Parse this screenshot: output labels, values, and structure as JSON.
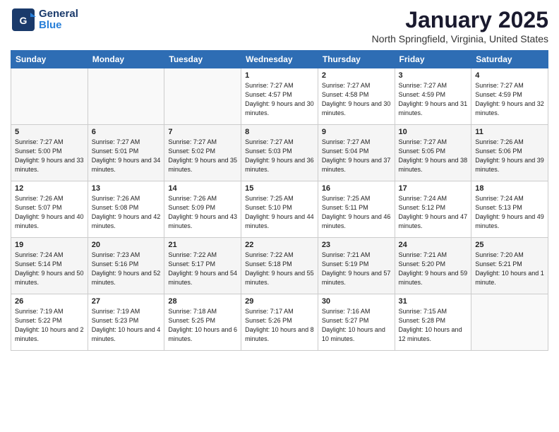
{
  "header": {
    "logo_general": "General",
    "logo_blue": "Blue",
    "month": "January 2025",
    "location": "North Springfield, Virginia, United States"
  },
  "weekdays": [
    "Sunday",
    "Monday",
    "Tuesday",
    "Wednesday",
    "Thursday",
    "Friday",
    "Saturday"
  ],
  "weeks": [
    [
      {
        "day": "",
        "sunrise": "",
        "sunset": "",
        "daylight": ""
      },
      {
        "day": "",
        "sunrise": "",
        "sunset": "",
        "daylight": ""
      },
      {
        "day": "",
        "sunrise": "",
        "sunset": "",
        "daylight": ""
      },
      {
        "day": "1",
        "sunrise": "Sunrise: 7:27 AM",
        "sunset": "Sunset: 4:57 PM",
        "daylight": "Daylight: 9 hours and 30 minutes."
      },
      {
        "day": "2",
        "sunrise": "Sunrise: 7:27 AM",
        "sunset": "Sunset: 4:58 PM",
        "daylight": "Daylight: 9 hours and 30 minutes."
      },
      {
        "day": "3",
        "sunrise": "Sunrise: 7:27 AM",
        "sunset": "Sunset: 4:59 PM",
        "daylight": "Daylight: 9 hours and 31 minutes."
      },
      {
        "day": "4",
        "sunrise": "Sunrise: 7:27 AM",
        "sunset": "Sunset: 4:59 PM",
        "daylight": "Daylight: 9 hours and 32 minutes."
      }
    ],
    [
      {
        "day": "5",
        "sunrise": "Sunrise: 7:27 AM",
        "sunset": "Sunset: 5:00 PM",
        "daylight": "Daylight: 9 hours and 33 minutes."
      },
      {
        "day": "6",
        "sunrise": "Sunrise: 7:27 AM",
        "sunset": "Sunset: 5:01 PM",
        "daylight": "Daylight: 9 hours and 34 minutes."
      },
      {
        "day": "7",
        "sunrise": "Sunrise: 7:27 AM",
        "sunset": "Sunset: 5:02 PM",
        "daylight": "Daylight: 9 hours and 35 minutes."
      },
      {
        "day": "8",
        "sunrise": "Sunrise: 7:27 AM",
        "sunset": "Sunset: 5:03 PM",
        "daylight": "Daylight: 9 hours and 36 minutes."
      },
      {
        "day": "9",
        "sunrise": "Sunrise: 7:27 AM",
        "sunset": "Sunset: 5:04 PM",
        "daylight": "Daylight: 9 hours and 37 minutes."
      },
      {
        "day": "10",
        "sunrise": "Sunrise: 7:27 AM",
        "sunset": "Sunset: 5:05 PM",
        "daylight": "Daylight: 9 hours and 38 minutes."
      },
      {
        "day": "11",
        "sunrise": "Sunrise: 7:26 AM",
        "sunset": "Sunset: 5:06 PM",
        "daylight": "Daylight: 9 hours and 39 minutes."
      }
    ],
    [
      {
        "day": "12",
        "sunrise": "Sunrise: 7:26 AM",
        "sunset": "Sunset: 5:07 PM",
        "daylight": "Daylight: 9 hours and 40 minutes."
      },
      {
        "day": "13",
        "sunrise": "Sunrise: 7:26 AM",
        "sunset": "Sunset: 5:08 PM",
        "daylight": "Daylight: 9 hours and 42 minutes."
      },
      {
        "day": "14",
        "sunrise": "Sunrise: 7:26 AM",
        "sunset": "Sunset: 5:09 PM",
        "daylight": "Daylight: 9 hours and 43 minutes."
      },
      {
        "day": "15",
        "sunrise": "Sunrise: 7:25 AM",
        "sunset": "Sunset: 5:10 PM",
        "daylight": "Daylight: 9 hours and 44 minutes."
      },
      {
        "day": "16",
        "sunrise": "Sunrise: 7:25 AM",
        "sunset": "Sunset: 5:11 PM",
        "daylight": "Daylight: 9 hours and 46 minutes."
      },
      {
        "day": "17",
        "sunrise": "Sunrise: 7:24 AM",
        "sunset": "Sunset: 5:12 PM",
        "daylight": "Daylight: 9 hours and 47 minutes."
      },
      {
        "day": "18",
        "sunrise": "Sunrise: 7:24 AM",
        "sunset": "Sunset: 5:13 PM",
        "daylight": "Daylight: 9 hours and 49 minutes."
      }
    ],
    [
      {
        "day": "19",
        "sunrise": "Sunrise: 7:24 AM",
        "sunset": "Sunset: 5:14 PM",
        "daylight": "Daylight: 9 hours and 50 minutes."
      },
      {
        "day": "20",
        "sunrise": "Sunrise: 7:23 AM",
        "sunset": "Sunset: 5:16 PM",
        "daylight": "Daylight: 9 hours and 52 minutes."
      },
      {
        "day": "21",
        "sunrise": "Sunrise: 7:22 AM",
        "sunset": "Sunset: 5:17 PM",
        "daylight": "Daylight: 9 hours and 54 minutes."
      },
      {
        "day": "22",
        "sunrise": "Sunrise: 7:22 AM",
        "sunset": "Sunset: 5:18 PM",
        "daylight": "Daylight: 9 hours and 55 minutes."
      },
      {
        "day": "23",
        "sunrise": "Sunrise: 7:21 AM",
        "sunset": "Sunset: 5:19 PM",
        "daylight": "Daylight: 9 hours and 57 minutes."
      },
      {
        "day": "24",
        "sunrise": "Sunrise: 7:21 AM",
        "sunset": "Sunset: 5:20 PM",
        "daylight": "Daylight: 9 hours and 59 minutes."
      },
      {
        "day": "25",
        "sunrise": "Sunrise: 7:20 AM",
        "sunset": "Sunset: 5:21 PM",
        "daylight": "Daylight: 10 hours and 1 minute."
      }
    ],
    [
      {
        "day": "26",
        "sunrise": "Sunrise: 7:19 AM",
        "sunset": "Sunset: 5:22 PM",
        "daylight": "Daylight: 10 hours and 2 minutes."
      },
      {
        "day": "27",
        "sunrise": "Sunrise: 7:19 AM",
        "sunset": "Sunset: 5:23 PM",
        "daylight": "Daylight: 10 hours and 4 minutes."
      },
      {
        "day": "28",
        "sunrise": "Sunrise: 7:18 AM",
        "sunset": "Sunset: 5:25 PM",
        "daylight": "Daylight: 10 hours and 6 minutes."
      },
      {
        "day": "29",
        "sunrise": "Sunrise: 7:17 AM",
        "sunset": "Sunset: 5:26 PM",
        "daylight": "Daylight: 10 hours and 8 minutes."
      },
      {
        "day": "30",
        "sunrise": "Sunrise: 7:16 AM",
        "sunset": "Sunset: 5:27 PM",
        "daylight": "Daylight: 10 hours and 10 minutes."
      },
      {
        "day": "31",
        "sunrise": "Sunrise: 7:15 AM",
        "sunset": "Sunset: 5:28 PM",
        "daylight": "Daylight: 10 hours and 12 minutes."
      },
      {
        "day": "",
        "sunrise": "",
        "sunset": "",
        "daylight": ""
      }
    ]
  ]
}
